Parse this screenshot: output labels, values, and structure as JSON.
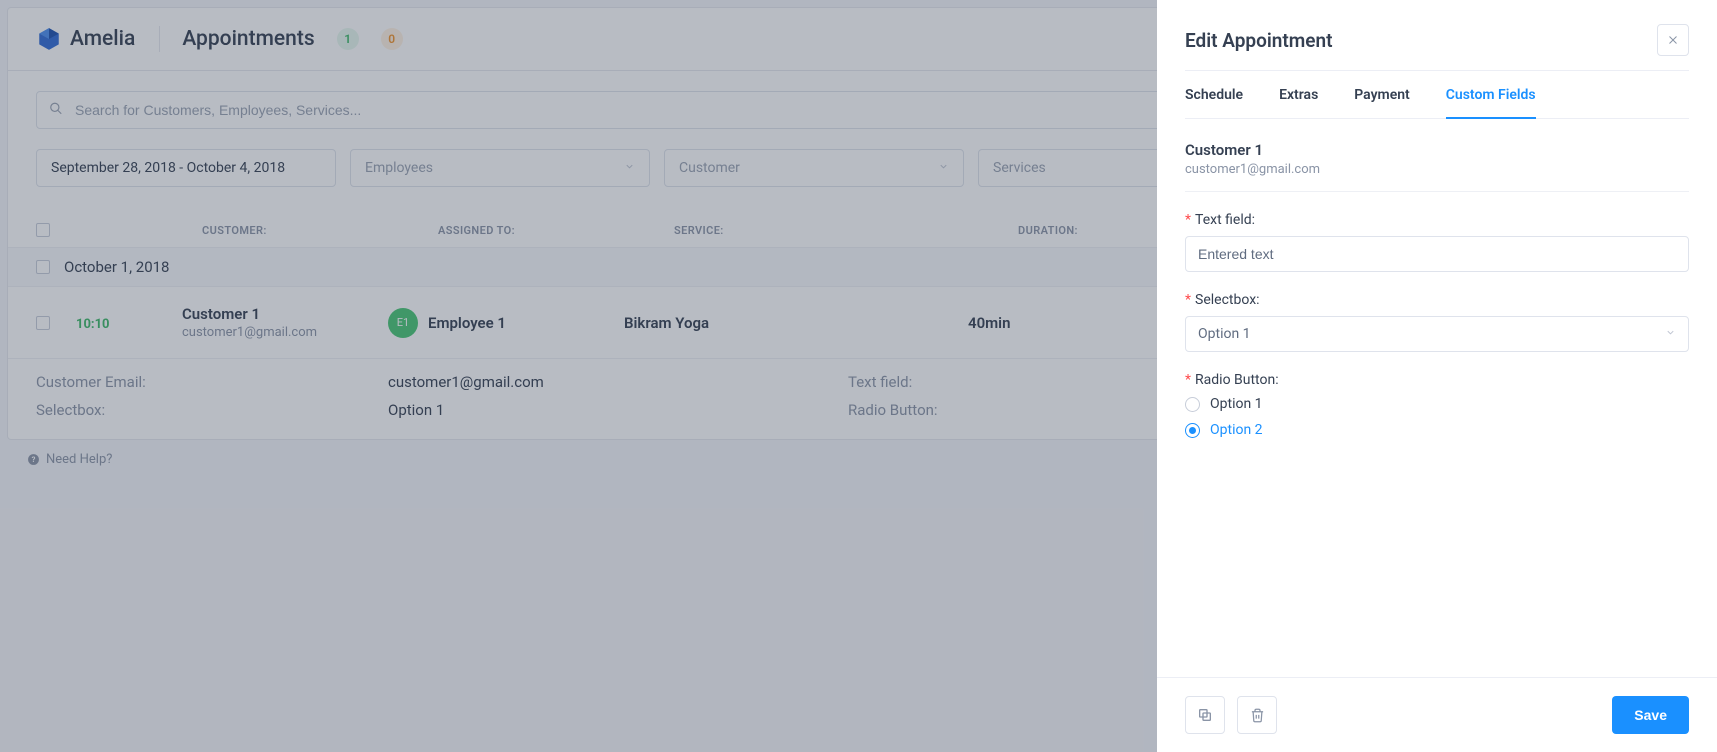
{
  "header": {
    "logoText": "Amelia",
    "pageTitle": "Appointments",
    "badgeGreen": "1",
    "badgeOrange": "0"
  },
  "filters": {
    "searchPlaceholder": "Search for Customers, Employees, Services...",
    "dateRange": "September 28, 2018 - October 4, 2018",
    "employeesPlaceholder": "Employees",
    "customerPlaceholder": "Customer",
    "servicesPlaceholder": "Services"
  },
  "table": {
    "headers": {
      "customer": "CUSTOMER:",
      "assigned": "ASSIGNED TO:",
      "service": "SERVICE:",
      "duration": "DURATION:"
    },
    "dateGroup": "October 1, 2018",
    "row": {
      "time": "10:10",
      "customerName": "Customer 1",
      "customerEmail": "customer1@gmail.com",
      "employeeInitials": "E1",
      "employeeName": "Employee 1",
      "serviceName": "Bikram Yoga",
      "duration": "40min"
    },
    "details": {
      "customerEmailLabel": "Customer Email:",
      "customerEmailValue": "customer1@gmail.com",
      "selectboxLabel": "Selectbox:",
      "selectboxValue": "Option 1",
      "textFieldLabel": "Text field:",
      "radioButtonLabel": "Radio Button:"
    }
  },
  "footer": {
    "helpText": "Need Help?"
  },
  "panel": {
    "title": "Edit Appointment",
    "tabs": {
      "schedule": "Schedule",
      "extras": "Extras",
      "payment": "Payment",
      "customFields": "Custom Fields"
    },
    "customer": {
      "name": "Customer 1",
      "email": "customer1@gmail.com"
    },
    "fields": {
      "textFieldLabel": "Text field:",
      "textFieldValue": "Entered text",
      "selectboxLabel": "Selectbox:",
      "selectboxValue": "Option 1",
      "radioLabel": "Radio Button:",
      "radioOpt1": "Option 1",
      "radioOpt2": "Option 2"
    },
    "saveLabel": "Save"
  }
}
